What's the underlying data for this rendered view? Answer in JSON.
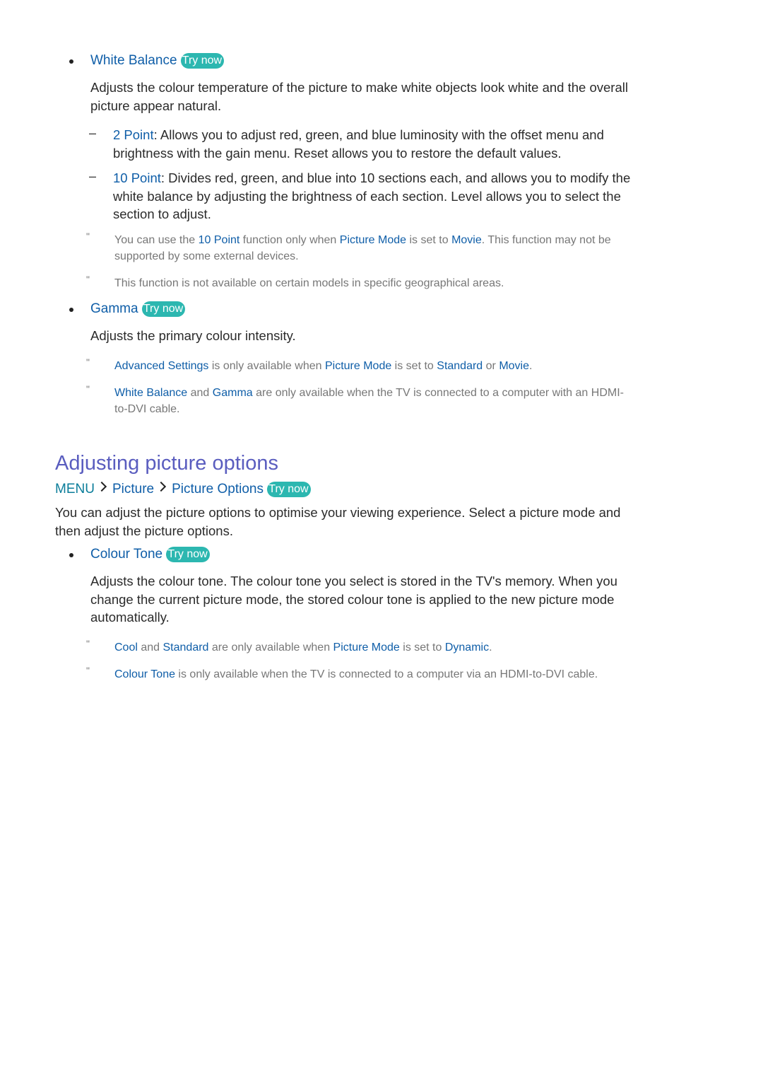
{
  "try_now_label": "Try now",
  "colors": {
    "keyword": "#0f5ea8",
    "menu": "#0b7d9a",
    "heading": "#5a5dbf",
    "try_now_bg": "#2cb7b0",
    "note": "#777777"
  },
  "white_balance": {
    "title": "White Balance",
    "description": [
      "Adjusts the colour temperature of the picture to make white objects look white and the overall",
      "picture appear natural."
    ],
    "sub_items": [
      {
        "keyword": "2 Point",
        "lines": [
          ": Allows you to adjust red, green, and blue luminosity with the offset menu and",
          "brightness with the gain menu. Reset allows you to restore the default values."
        ]
      },
      {
        "keyword": "10 Point",
        "lines": [
          ": Divides red, green, and blue into 10 sections each, and allows you to modify the",
          "white balance by adjusting the brightness of each section. Level allows you to select the",
          "section to adjust."
        ]
      }
    ],
    "notes": [
      {
        "parts": [
          "You can use the ",
          "10 Point",
          " function only when ",
          "Picture Mode",
          " is set to ",
          "Movie",
          ". This function may not be"
        ],
        "line2": "supported by some external devices."
      },
      {
        "text": "This function is not available on certain models in specific geographical areas."
      }
    ]
  },
  "gamma": {
    "title": "Gamma",
    "description": "Adjusts the primary colour intensity.",
    "notes": [
      {
        "parts": [
          "Advanced Settings",
          " is only available when ",
          "Picture Mode",
          " is set to ",
          "Standard",
          " or ",
          "Movie",
          "."
        ]
      },
      {
        "parts": [
          "White Balance",
          " and ",
          "Gamma",
          " are only available when the TV is connected to a computer with an HDMI-"
        ],
        "line2": "to-DVI cable."
      }
    ]
  },
  "section": {
    "heading": "Adjusting picture options",
    "breadcrumb": [
      "MENU",
      "Picture",
      "Picture Options"
    ],
    "intro": [
      "You can adjust the picture options to optimise your viewing experience. Select a picture mode and",
      "then adjust the picture options."
    ]
  },
  "colour_tone": {
    "title": "Colour Tone",
    "description": [
      "Adjusts the colour tone. The colour tone you select is stored in the TV's memory. When you",
      "change the current picture mode, the stored colour tone is applied to the new picture mode",
      "automatically."
    ],
    "notes": [
      {
        "parts": [
          "Cool",
          " and ",
          "Standard",
          " are only available when ",
          "Picture Mode",
          " is set to ",
          "Dynamic",
          "."
        ]
      },
      {
        "parts": [
          "Colour Tone",
          " is only available when the TV is connected to a computer via an HDMI-to-DVI cable."
        ]
      }
    ]
  },
  "note_marker": "\""
}
